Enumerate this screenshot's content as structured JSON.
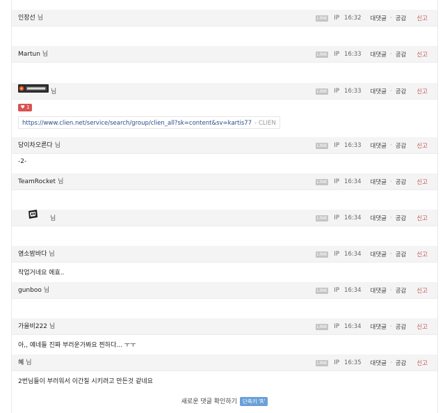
{
  "common": {
    "link_label": "LINK",
    "ip_label": "IP",
    "reply_label": "대댓글",
    "dot": "·",
    "like_label": "공감",
    "report_label": "신고",
    "nim": "님"
  },
  "comments": [
    {
      "nick": "인장선",
      "time": "16:32",
      "body": ""
    },
    {
      "nick": "Martun",
      "time": "16:33",
      "body": ""
    },
    {
      "nick": "",
      "nick_icon": "nickname-image",
      "time": "16:33",
      "heart": "1",
      "url": "https://www.clien.net/service/search/group/clien_all?sk=content&sv=kartis77",
      "url_source": "- CLIEN"
    },
    {
      "nick": "당이차오른다",
      "time": "16:33",
      "body": "-2-"
    },
    {
      "nick": "TeamRocket",
      "time": "16:34",
      "body": ""
    },
    {
      "nick": "",
      "nick_icon": "nickname-image",
      "time": "16:34",
      "body": ""
    },
    {
      "nick": "염소밤바다",
      "time": "16:34",
      "body": "작업거네요 에효.."
    },
    {
      "nick": "gunboo",
      "time": "16:34",
      "body": ""
    },
    {
      "nick": "가을비222",
      "time": "16:34",
      "body": "아,, 얘네들 진짜 부러운가봐요 찐하다... ㅜㅜ"
    },
    {
      "nick": "혜",
      "time": "16:35",
      "body": "2번님들이 부러워서 이간질 시키려고 만든것 같네요"
    }
  ],
  "footer": {
    "text": "새로운 댓글 확인하기",
    "shortcut": "단축키 'R'"
  }
}
